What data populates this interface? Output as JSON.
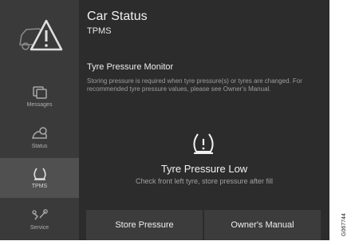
{
  "header": {
    "title": "Car Status",
    "subtitle": "TPMS"
  },
  "sidebar": {
    "items": [
      {
        "label": "Messages",
        "icon": "messages-icon",
        "active": false
      },
      {
        "label": "Status",
        "icon": "status-icon",
        "active": false
      },
      {
        "label": "TPMS",
        "icon": "tyre-icon",
        "active": true
      },
      {
        "label": "Service",
        "icon": "service-icon",
        "active": false
      }
    ]
  },
  "tpms": {
    "section_title": "Tyre Pressure Monitor",
    "description": "Storing pressure is required when tyre pressure(s) or tyres are changed. For recommended tyre pressure values, please see Owner's Manual.",
    "status_title": "Tyre Pressure Low",
    "status_detail": "Check front left tyre, store pressure after fill"
  },
  "buttons": {
    "store_pressure": "Store Pressure",
    "owners_manual": "Owner's Manual"
  },
  "figure_ref": "G067744",
  "colors": {
    "background": "#2c2c2c",
    "sidebar": "#3a3a3a",
    "active": "#505050",
    "text": "#f2f2f2"
  }
}
